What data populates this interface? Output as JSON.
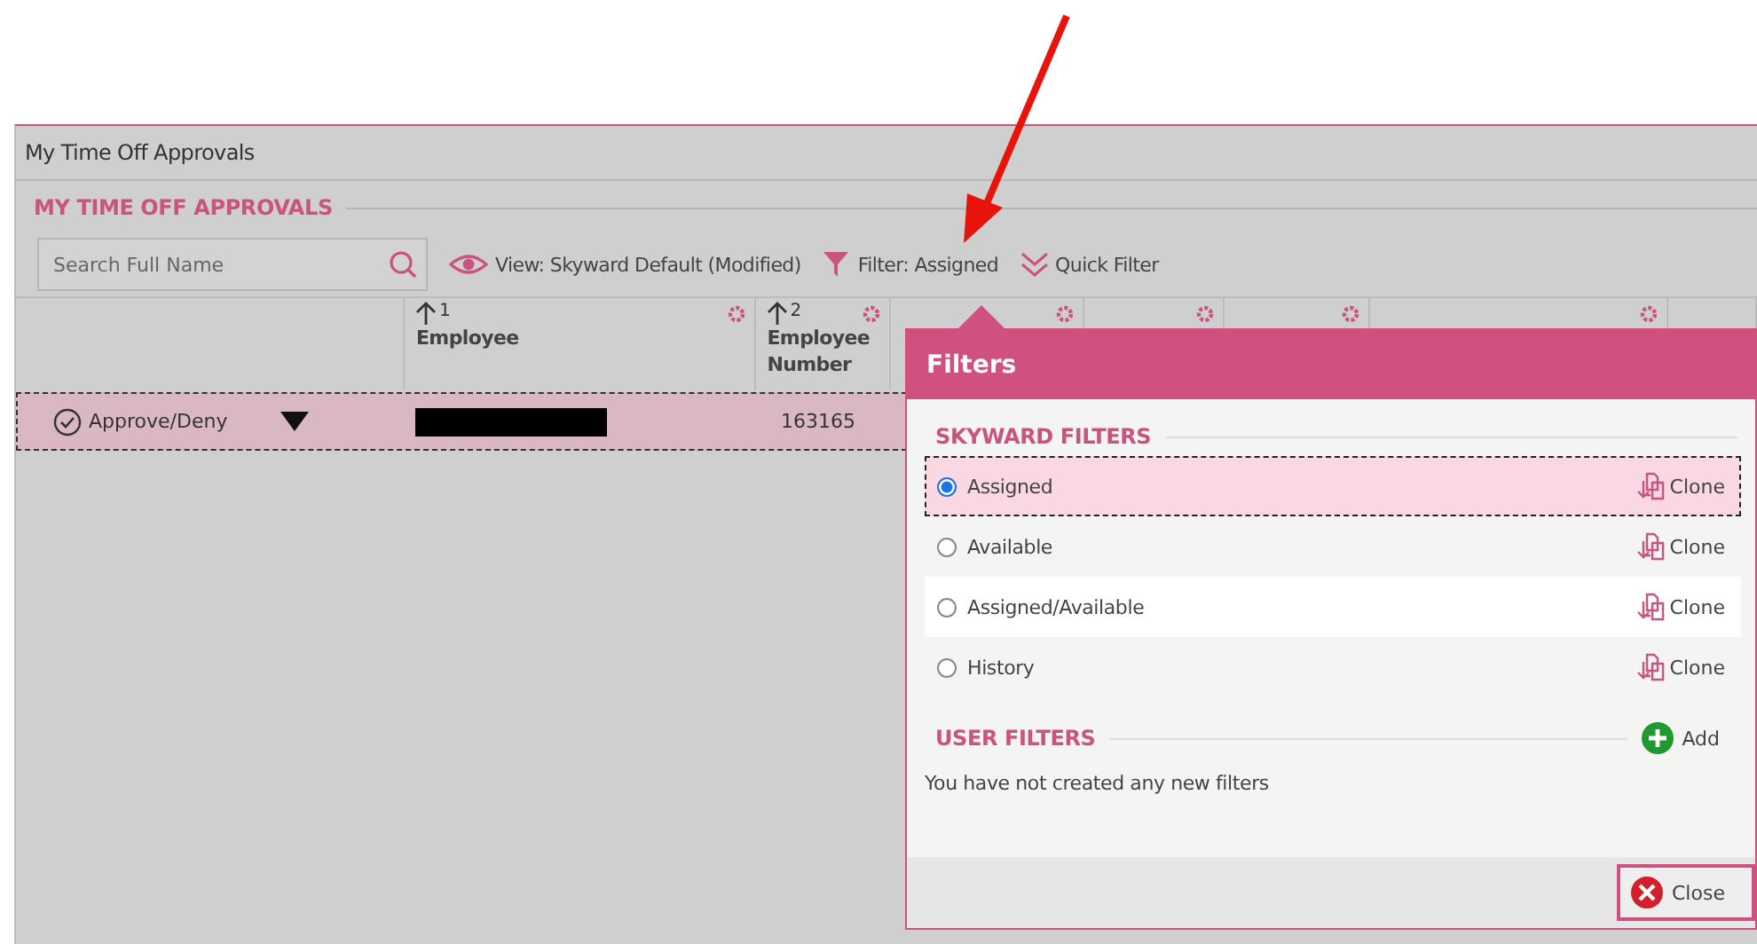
{
  "window": {
    "title": "My Time Off Approvals"
  },
  "section_title": "MY TIME OFF APPROVALS",
  "search": {
    "placeholder": "Search Full Name"
  },
  "toolbar": {
    "view": "View: Skyward Default (Modified)",
    "filter": "Filter: Assigned",
    "quick_filter": "Quick Filter"
  },
  "columns": [
    {
      "sort": "1",
      "label": "Employee"
    },
    {
      "sort": "2",
      "label": "Employee Number"
    }
  ],
  "rows": [
    {
      "action": "Approve/Deny",
      "employee_redacted": true,
      "employee_number": "163165",
      "selected": true
    }
  ],
  "filters_dialog": {
    "title": "Filters",
    "skyward_filters": {
      "title": "SKYWARD FILTERS",
      "items": [
        {
          "label": "Assigned",
          "selected": true,
          "action": "Clone"
        },
        {
          "label": "Available",
          "selected": false,
          "action": "Clone"
        },
        {
          "label": "Assigned/Available",
          "selected": false,
          "action": "Clone"
        },
        {
          "label": "History",
          "selected": false,
          "action": "Clone"
        }
      ]
    },
    "user_filters": {
      "title": "USER FILTERS",
      "add": "Add",
      "empty_message": "You have not created any new filters"
    },
    "close": "Close"
  }
}
